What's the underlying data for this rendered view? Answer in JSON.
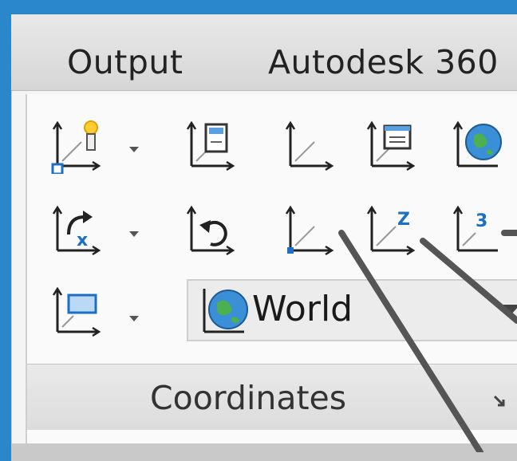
{
  "tabs": [
    {
      "label": "Output"
    },
    {
      "label": "Autodesk 360"
    }
  ],
  "panel": {
    "title": "Coordinates",
    "coordinate_combo": {
      "value": "World"
    }
  },
  "icons": {
    "ucs_main": "ucs-light-bulb-icon",
    "ucs_view": "ucs-view-icon",
    "ucs_plain": "ucs-icon",
    "ucs_named": "ucs-named-icon",
    "ucs_world": "ucs-world-globe-icon",
    "ucs_x": "ucs-x-rotate-icon",
    "ucs_previous": "ucs-previous-icon",
    "ucs_origin": "ucs-origin-icon",
    "ucs_z": "ucs-z-axis-icon",
    "ucs_3point": "ucs-3-point-icon",
    "ucs_face": "ucs-face-icon"
  },
  "glyphs": {
    "x_axis": "x",
    "z_axis": "Z",
    "three_point": "3"
  },
  "colors": {
    "background": "#2a87c9",
    "accent_blue": "#1d6fc4"
  }
}
